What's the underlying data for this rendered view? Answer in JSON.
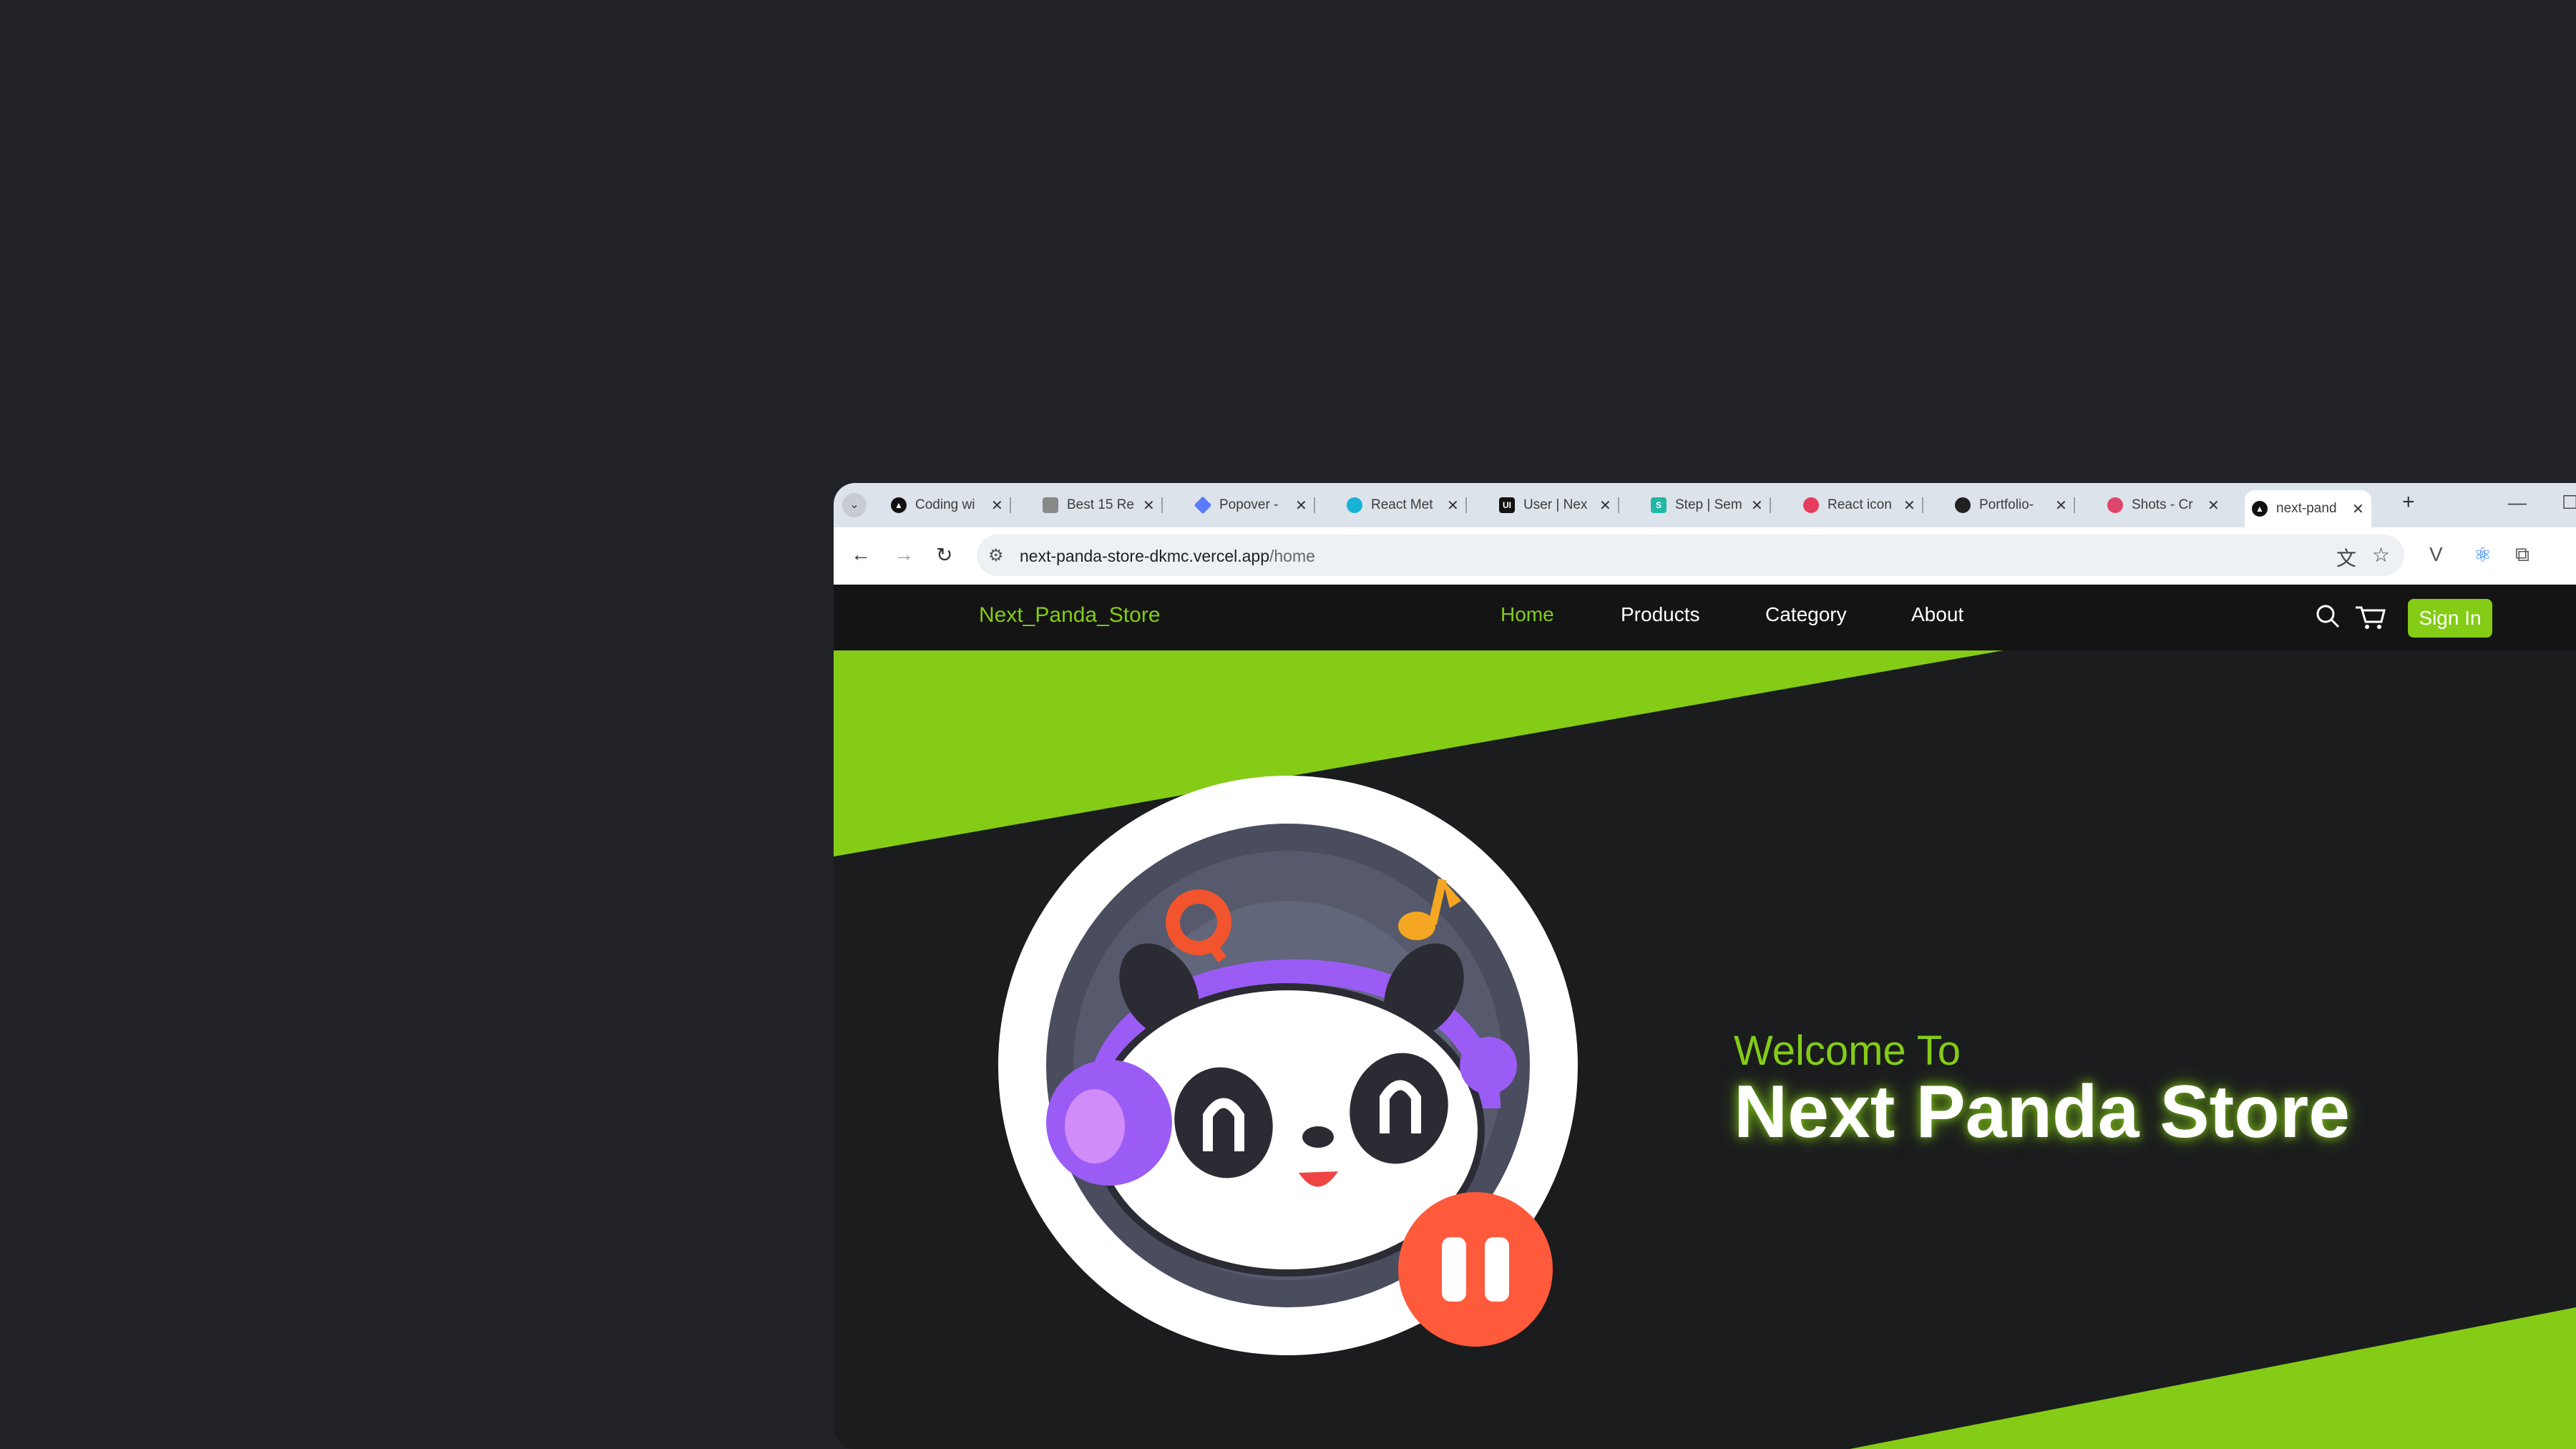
{
  "browser": {
    "tabs": [
      {
        "title": "Coding wi",
        "favicon": "triangle-icon",
        "color": "#111111"
      },
      {
        "title": "Best 15 Re",
        "favicon": "page-icon",
        "color": "#777777"
      },
      {
        "title": "Popover -",
        "favicon": "diamond-icon",
        "color": "#5b7cfa"
      },
      {
        "title": "React Met",
        "favicon": "react-icon",
        "color": "#16b3d6"
      },
      {
        "title": "User | Nex",
        "favicon": "ui-icon",
        "color": "#111111"
      },
      {
        "title": "Step | Sem",
        "favicon": "s-icon",
        "color": "#22b8a6"
      },
      {
        "title": "React icon",
        "favicon": "react-icon",
        "color": "#e33c5c"
      },
      {
        "title": "Portfolio-",
        "favicon": "github-icon",
        "color": "#222222"
      },
      {
        "title": "Shots - Cr",
        "favicon": "dribbble-icon",
        "color": "#e0456b"
      },
      {
        "title": "next-pand",
        "favicon": "triangle-icon",
        "color": "#111111"
      }
    ],
    "address": {
      "host": "next-panda-store-dkmc.vercel.app",
      "path": "/home"
    }
  },
  "site": {
    "logo": "Next_Panda_Store",
    "nav": [
      "Home",
      "Products",
      "Category",
      "About"
    ],
    "signin": "Sign In",
    "accent": "#84cc16"
  },
  "hero": {
    "welcome": "Welcome To",
    "title": "Next Panda Store"
  }
}
